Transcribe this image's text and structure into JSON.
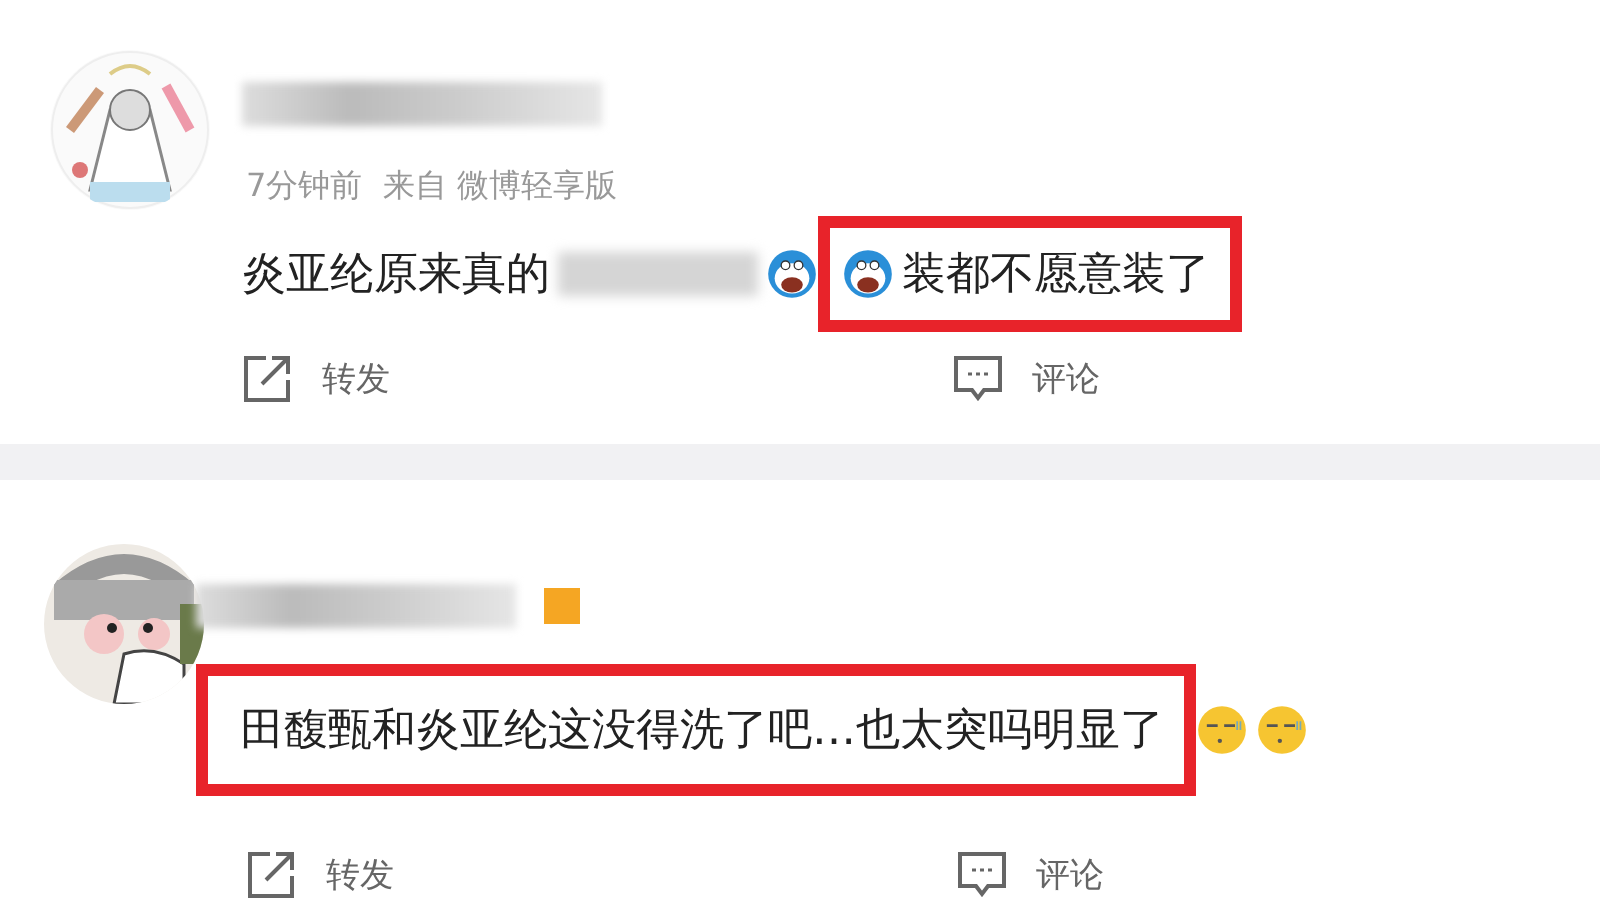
{
  "comments": [
    {
      "avatar": {
        "kind": "picture"
      },
      "name_badge": false,
      "meta": "7分钟前  来自 微博轻享版",
      "segments": [
        {
          "kind": "text",
          "text": "炎亚纶原来真的",
          "highlighted": false
        },
        {
          "kind": "redacted",
          "highlighted": false
        },
        {
          "kind": "cartoon",
          "highlighted": false
        },
        {
          "kind": "cartoon",
          "highlighted": true
        },
        {
          "kind": "text",
          "text": "装都不愿意装了",
          "highlighted": true
        }
      ],
      "actions": [
        {
          "kind": "share",
          "label": "转发"
        },
        {
          "kind": "comment",
          "label": "评论"
        }
      ]
    },
    {
      "avatar": {
        "kind": "picture"
      },
      "name_badge": true,
      "segments": [
        {
          "kind": "text",
          "text": "田馥甄和炎亚纶这没得洗了吧…也太突吗明显了",
          "highlighted": true
        },
        {
          "kind": "smiley",
          "highlighted": false
        },
        {
          "kind": "smiley",
          "highlighted": false
        }
      ],
      "actions": [
        {
          "kind": "share",
          "label": "转发"
        },
        {
          "kind": "comment",
          "label": "评论"
        }
      ]
    }
  ]
}
